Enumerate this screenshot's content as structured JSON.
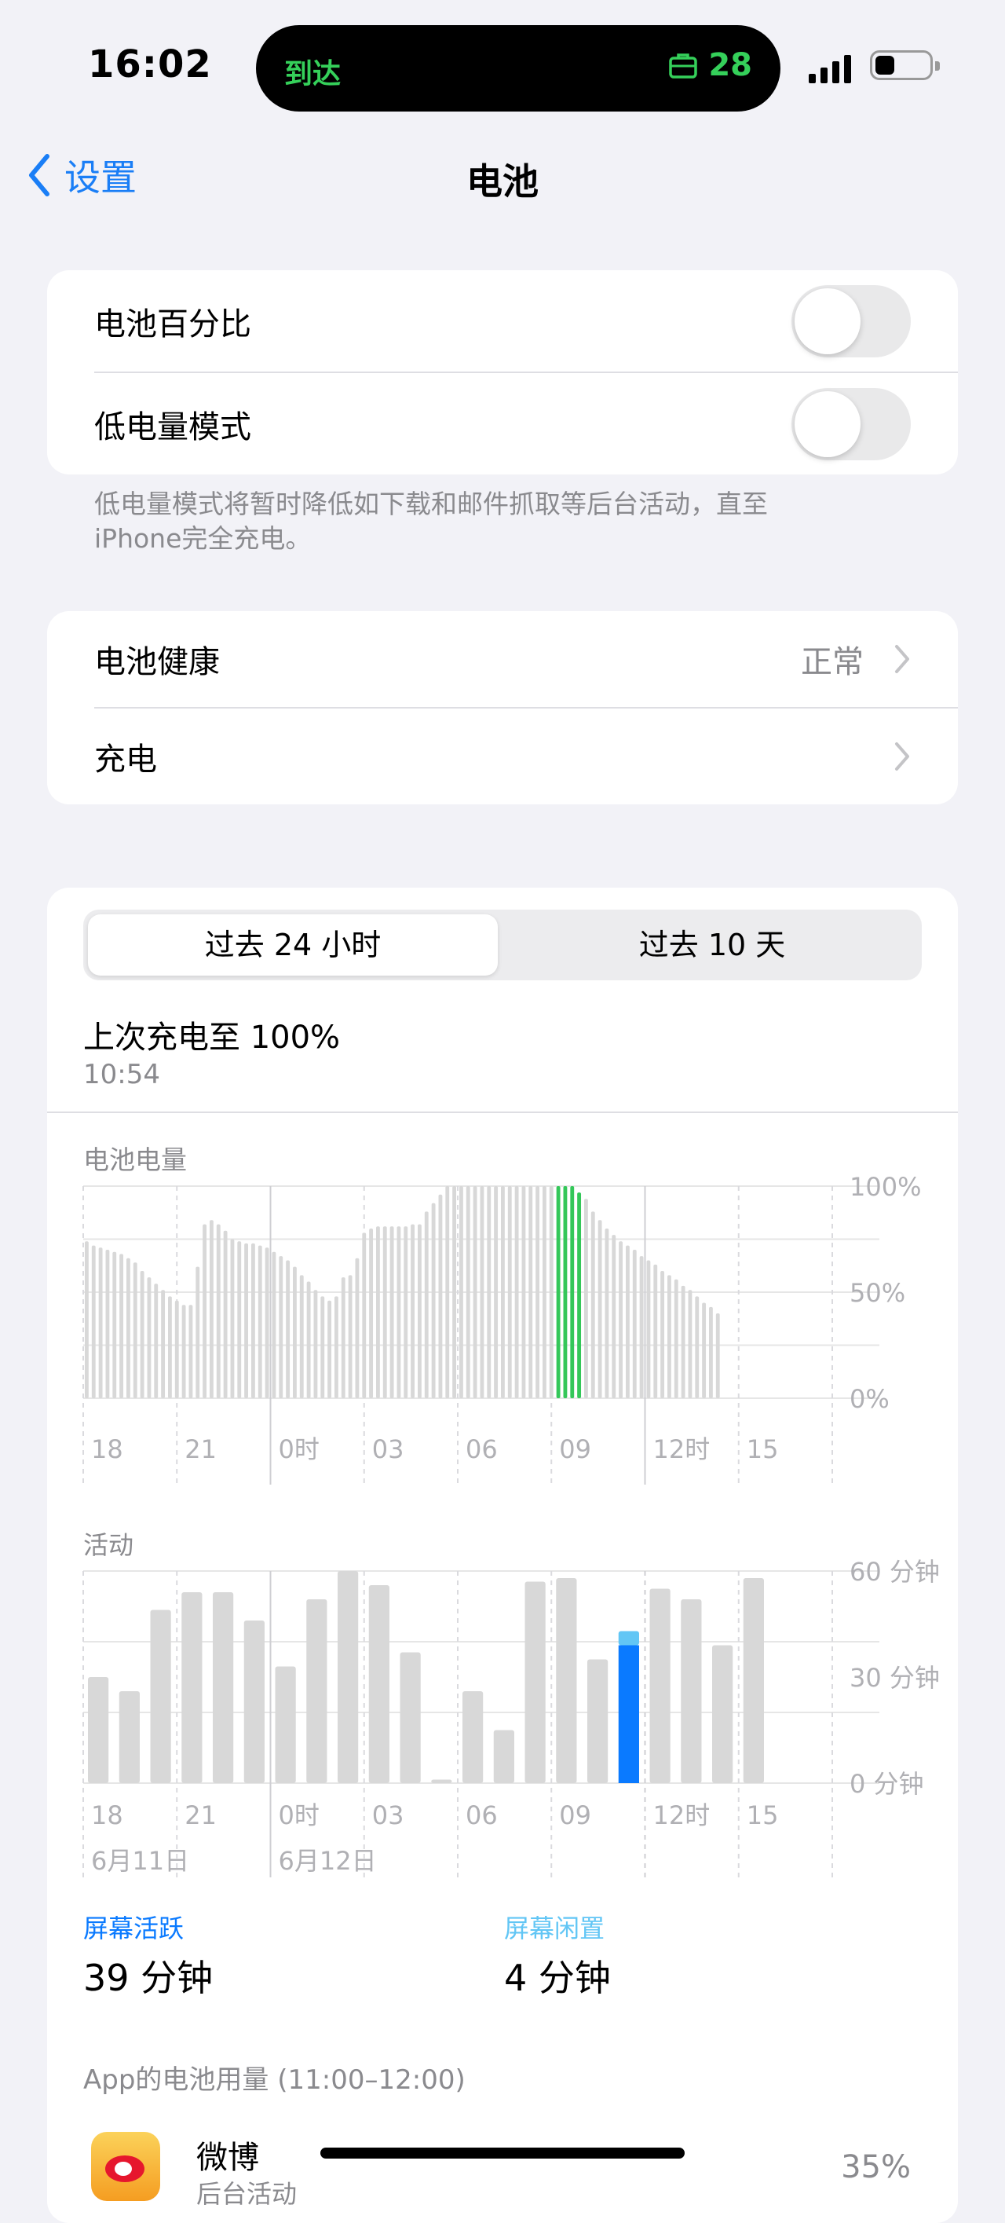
{
  "status_bar": {
    "time": "16:02",
    "island_left": "到达",
    "island_right": "28",
    "accent": "#35d05a"
  },
  "nav": {
    "back_label": "设置",
    "title": "电池"
  },
  "toggles": [
    {
      "label": "电池百分比",
      "on": false
    },
    {
      "label": "低电量模式",
      "on": false
    }
  ],
  "low_power_note": "低电量模式将暂时降低如下载和邮件抓取等后台活动，直至iPhone完全充电。",
  "health": {
    "label": "电池健康",
    "value": "正常",
    "charging_label": "充电"
  },
  "usage": {
    "tabs": [
      "过去 24 小时",
      "过去 10 天"
    ],
    "selected_tab": 0,
    "last_charge_title": "上次充电至 100%",
    "last_charge_time": "10:54",
    "screen_on_label": "屏幕活跃",
    "screen_on_value": "39 分钟",
    "screen_off_label": "屏幕闲置",
    "screen_off_value": "4 分钟",
    "app_usage_header": "App的电池用量 (11:00–12:00)",
    "app": {
      "name": "微博",
      "sub": "后台活动",
      "percent": "35%"
    }
  },
  "chart_data": [
    {
      "type": "bar",
      "title": "电池电量",
      "x_tick_labels": [
        "18",
        "21",
        "0时",
        "03",
        "06",
        "09",
        "12时",
        "15"
      ],
      "y_tick_labels": [
        "100%",
        "50%",
        "0%"
      ],
      "ylim": [
        0,
        100
      ],
      "values": [
        74,
        72,
        71,
        70,
        69,
        68,
        66,
        64,
        60,
        57,
        54,
        51,
        48,
        46,
        44,
        44,
        62,
        82,
        84,
        82,
        79,
        75,
        74,
        73,
        73,
        72,
        71,
        69,
        67,
        65,
        62,
        58,
        55,
        51,
        48,
        46,
        48,
        57,
        58,
        66,
        78,
        80,
        81,
        81,
        81,
        81,
        81,
        82,
        82,
        88,
        92,
        96,
        100,
        100,
        100,
        100,
        100,
        100,
        100,
        100,
        100,
        100,
        100,
        100,
        100,
        100,
        100,
        100,
        100,
        100,
        100,
        97,
        94,
        88,
        84,
        80,
        77,
        74,
        72,
        70,
        67,
        65,
        63,
        60,
        58,
        56,
        53,
        51,
        48,
        45,
        43,
        40
      ],
      "charging_index_range": [
        68,
        71
      ],
      "colors": {
        "bar": "#d8d8d8",
        "charging": "#34c759"
      }
    },
    {
      "type": "bar",
      "title": "活动",
      "x_tick_labels": [
        "18",
        "21",
        "0时",
        "03",
        "06",
        "09",
        "12时",
        "15"
      ],
      "date_labels": [
        "6月11日",
        "6月12日"
      ],
      "y_tick_labels": [
        "60 分钟",
        "30 分钟",
        "0 分钟"
      ],
      "ylim": [
        0,
        60
      ],
      "values": [
        30,
        26,
        49,
        54,
        54,
        46,
        33,
        52,
        60,
        56,
        37,
        1,
        26,
        15,
        57,
        58,
        35,
        43,
        55,
        52,
        39,
        58
      ],
      "highlight_index": 17,
      "highlight_split": {
        "screen_on": 39,
        "screen_off": 4
      },
      "colors": {
        "bar": "#d8d8d8",
        "screen_on": "#0a7aff",
        "screen_off": "#62c6f5"
      }
    }
  ]
}
